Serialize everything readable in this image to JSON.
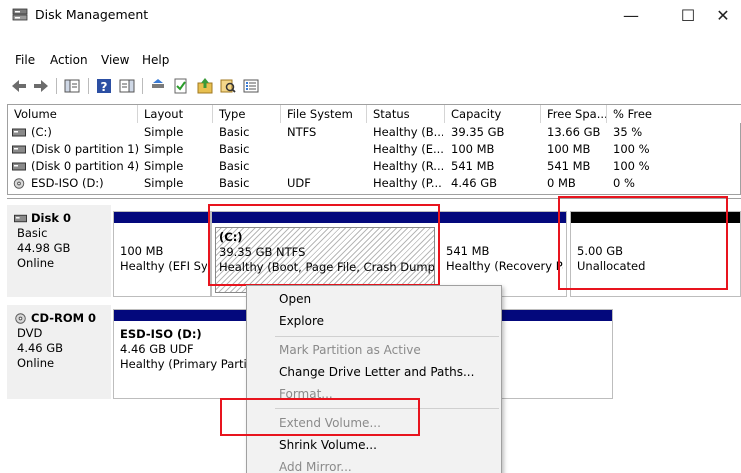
{
  "window": {
    "title": "Disk Management",
    "minimize": "—",
    "maximize": "☐",
    "close": "✕"
  },
  "menu": [
    "File",
    "Action",
    "View",
    "Help"
  ],
  "volume_table": {
    "headers": [
      "Volume",
      "Layout",
      "Type",
      "File System",
      "Status",
      "Capacity",
      "Free Spa...",
      "% Free"
    ],
    "rows": [
      [
        "(C:)",
        "Simple",
        "Basic",
        "NTFS",
        "Healthy (B...",
        "39.35 GB",
        "13.66 GB",
        "35 %"
      ],
      [
        "(Disk 0 partition 1)",
        "Simple",
        "Basic",
        "",
        "Healthy (E...",
        "100 MB",
        "100 MB",
        "100 %"
      ],
      [
        "(Disk 0 partition 4)",
        "Simple",
        "Basic",
        "",
        "Healthy (R...",
        "541 MB",
        "541 MB",
        "100 %"
      ],
      [
        "ESD-ISO (D:)",
        "Simple",
        "Basic",
        "UDF",
        "Healthy (P...",
        "4.46 GB",
        "0 MB",
        "0 %"
      ]
    ]
  },
  "disk0": {
    "name": "Disk 0",
    "type": "Basic",
    "size": "44.98 GB",
    "state": "Online",
    "partitions": [
      {
        "line1": "",
        "line2": "100 MB",
        "line3": "Healthy (EFI System Partition)"
      },
      {
        "line1": "(C:)",
        "line2": "39.35 GB NTFS",
        "line3": "Healthy (Boot, Page File, Crash Dump, Basic Data Partition)"
      },
      {
        "line1": "",
        "line2": "541 MB",
        "line3": "Healthy (Recovery Partition)"
      },
      {
        "line1": "",
        "line2": "5.00 GB",
        "line3": "Unallocated"
      }
    ]
  },
  "cdrom0": {
    "name": "CD-ROM 0",
    "type": "DVD",
    "size": "4.46 GB",
    "state": "Online",
    "partition": {
      "line1": "ESD-ISO  (D:)",
      "line2": "4.46 GB UDF",
      "line3": "Healthy (Primary Partition)"
    }
  },
  "context_menu": {
    "items": [
      {
        "label": "Open",
        "enabled": true
      },
      {
        "label": "Explore",
        "enabled": true
      },
      {
        "label": "Mark Partition as Active",
        "enabled": false
      },
      {
        "label": "Change Drive Letter and Paths...",
        "enabled": true
      },
      {
        "label": "Format...",
        "enabled": false
      },
      {
        "label": "Extend Volume...",
        "enabled": false
      },
      {
        "label": "Shrink Volume...",
        "enabled": true
      },
      {
        "label": "Add Mirror...",
        "enabled": false
      }
    ]
  },
  "colors": {
    "partition_bar": "#03087c",
    "unallocated_bar": "#000000",
    "highlight": "#e8141e",
    "disabled_text": "#8a8a8a"
  },
  "icons": [
    "disk-management-icon",
    "back-arrow-icon",
    "forward-arrow-icon",
    "console-tree-icon",
    "properties-icon",
    "help-icon",
    "action-pane-icon",
    "connect-icon",
    "check-icon",
    "up-icon",
    "search-icon",
    "list-icon",
    "drive-icon",
    "cd-icon"
  ]
}
